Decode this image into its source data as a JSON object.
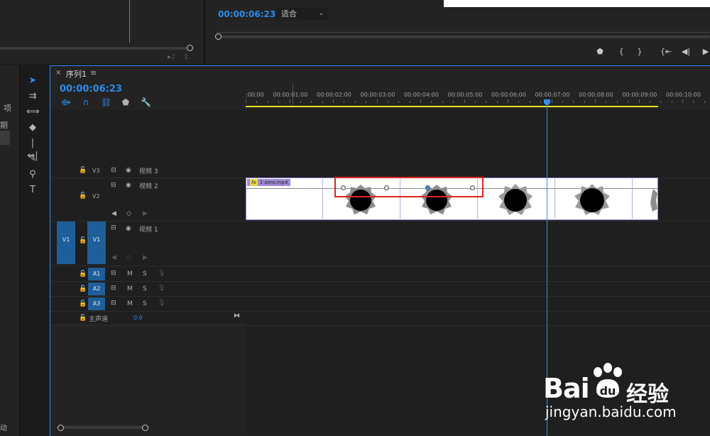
{
  "program_monitor": {
    "timecode": "00:00:06:23",
    "fit_value": "适合",
    "transport": [
      "marker-icon",
      "in-point-icon",
      "out-point-icon",
      "go-to-in-icon",
      "step-back-icon",
      "play-icon"
    ]
  },
  "project_panel": {
    "text_1": "项",
    "text_2": "期",
    "text_3": "动"
  },
  "timeline": {
    "title": "序列1",
    "menu_icon": "≡",
    "timecode": "00:00:06:23",
    "ruler": [
      ":00:00",
      "00:00:01:00",
      "00:00:02:00",
      "00:00:03:00",
      "00:00:04:00",
      "00:00:05:00",
      "00:00:06:00",
      "00:00:07:00",
      "00:00:08:00",
      "00:00:09:00",
      "00:00:10:00"
    ],
    "tracks": {
      "v3": {
        "id": "V3",
        "name": "视频 3"
      },
      "v2": {
        "id": "V2",
        "name": "视频 2"
      },
      "v1": {
        "id": "V1",
        "name": "视频 1",
        "source": "V1"
      },
      "a1": {
        "id": "A1",
        "m": "M",
        "s": "S"
      },
      "a2": {
        "id": "A2",
        "m": "M",
        "s": "S"
      },
      "a3": {
        "id": "A3",
        "m": "M",
        "s": "S"
      },
      "master": {
        "name": "主声道",
        "value": "0.0"
      }
    },
    "clip": {
      "name": "1-zero.mp4",
      "fx": "fx"
    }
  },
  "watermark": {
    "brand": "Bai",
    "brand2": "经验",
    "url": "jingyan.baidu.com"
  },
  "colors": {
    "accent": "#2d8ceb",
    "highlight": "#e0241d",
    "work_area": "#e6e61e",
    "clip_label": "#a08ad6"
  }
}
